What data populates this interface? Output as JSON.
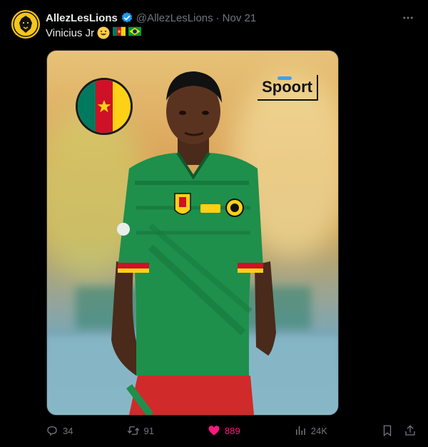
{
  "tweet": {
    "author_name": "AllezLesLions",
    "handle": "@AllezLesLions",
    "separator": "·",
    "date": "Nov 21",
    "text": "Vinicius Jr"
  },
  "media": {
    "watermark": "Spoort"
  },
  "actions": {
    "replies": "34",
    "retweets": "91",
    "likes": "889",
    "views": "24K"
  },
  "colors": {
    "like_active": "#f91880",
    "verified": "#1d9bf0",
    "cameroon_green": "#007a5e",
    "cameroon_red": "#ce1126",
    "cameroon_yellow": "#fcd116"
  }
}
